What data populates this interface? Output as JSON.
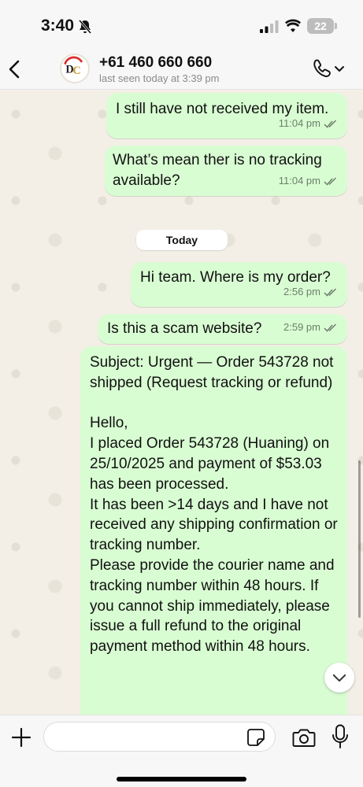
{
  "status_bar": {
    "time": "3:40",
    "battery": "22",
    "icons": [
      "bell-slash-icon",
      "signal-icon",
      "wifi-icon",
      "battery-icon"
    ]
  },
  "header": {
    "contact_name": "+61 460 660 660",
    "last_seen": "last seen today at 3:39 pm",
    "avatar_initials": "DC",
    "icons": [
      "back-icon",
      "phone-icon",
      "chevron-down-icon"
    ]
  },
  "date_separator": "Today",
  "messages": [
    {
      "text": "I still have not received my item.",
      "time": "11:04 pm"
    },
    {
      "text": "What’s mean ther is no tracking available?",
      "time": "11:04 pm"
    },
    {
      "text": "Hi team. Where is my order?",
      "time": "2:56 pm"
    },
    {
      "text": "Is this a scam website?",
      "time": "2:59 pm"
    },
    {
      "text": "Subject: Urgent — Order 543728 not shipped (Request tracking or refund)\n\nHello,\nI placed Order 543728 (Huaning) on 25/10/2025 and payment of $53.03 has been processed.\nIt has been >14 days and I have not received any shipping confirmation or tracking number.\nPlease provide the courier name and tracking number within 48 hours. If you cannot ship immediately, please issue a full refund to the original payment method within 48 hours.",
      "time": ""
    }
  ],
  "input": {
    "placeholder": "",
    "value": ""
  },
  "colors": {
    "outgoing_bubble": "#d9fdd3",
    "chat_background": "#f3efe6",
    "ticks": "#6b7f69"
  }
}
